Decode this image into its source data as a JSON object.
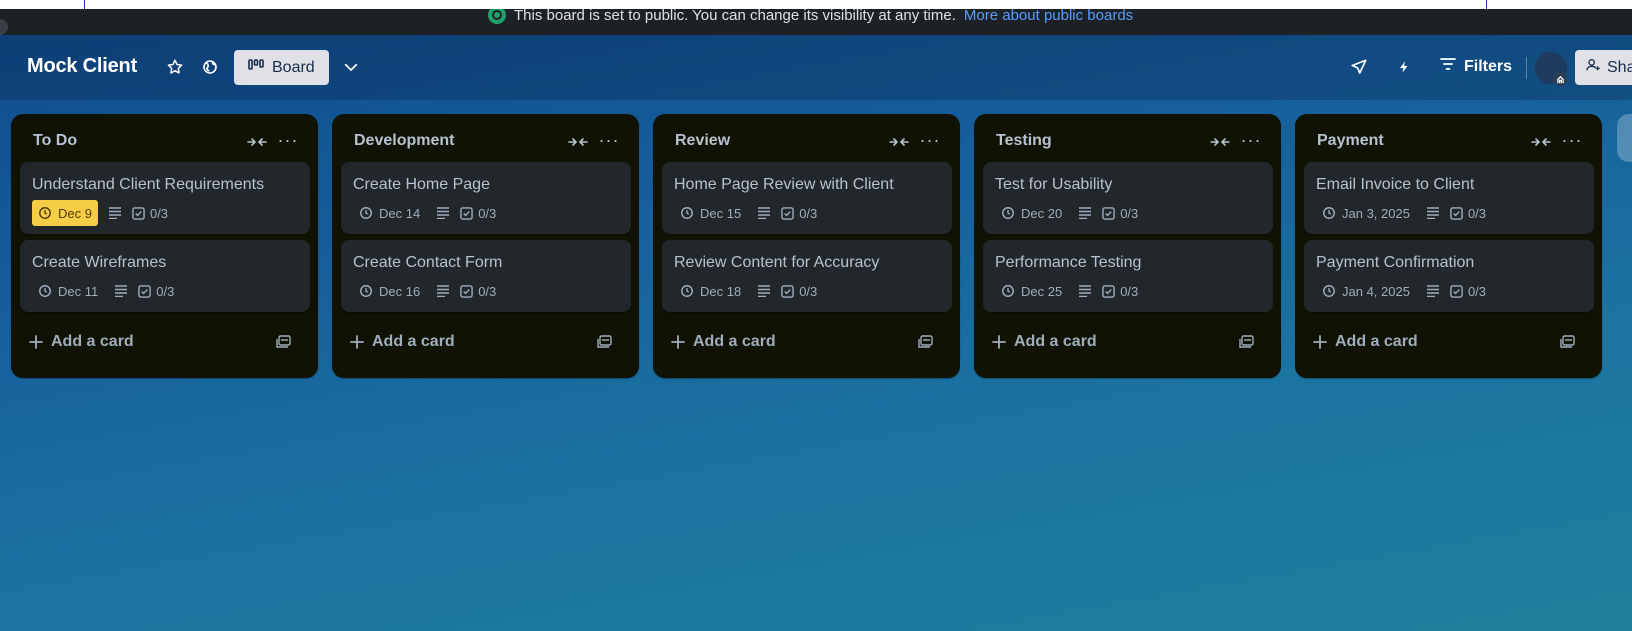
{
  "banner": {
    "text": "This board is set to public. You can change its visibility at any time.",
    "link": "More about public boards"
  },
  "header": {
    "board_title": "Mock Client",
    "view_label": "Board",
    "filters_label": "Filters",
    "share_label": "Share"
  },
  "lists": [
    {
      "title": "To Do",
      "cards": [
        {
          "title": "Understand Client Requirements",
          "due": "Dec 9",
          "due_soon": true,
          "checklist": "0/3"
        },
        {
          "title": "Create Wireframes",
          "due": "Dec 11",
          "due_soon": false,
          "checklist": "0/3"
        }
      ]
    },
    {
      "title": "Development",
      "cards": [
        {
          "title": "Create Home Page",
          "due": "Dec 14",
          "due_soon": false,
          "checklist": "0/3"
        },
        {
          "title": "Create Contact Form",
          "due": "Dec 16",
          "due_soon": false,
          "checklist": "0/3"
        }
      ]
    },
    {
      "title": "Review",
      "cards": [
        {
          "title": "Home Page Review with Client",
          "due": "Dec 15",
          "due_soon": false,
          "checklist": "0/3"
        },
        {
          "title": "Review Content for Accuracy",
          "due": "Dec 18",
          "due_soon": false,
          "checklist": "0/3"
        }
      ]
    },
    {
      "title": "Testing",
      "cards": [
        {
          "title": "Test for Usability",
          "due": "Dec 20",
          "due_soon": false,
          "checklist": "0/3"
        },
        {
          "title": "Performance Testing",
          "due": "Dec 25",
          "due_soon": false,
          "checklist": "0/3"
        }
      ]
    },
    {
      "title": "Payment",
      "cards": [
        {
          "title": "Email Invoice to Client",
          "due": "Jan 3, 2025",
          "due_soon": false,
          "checklist": "0/3"
        },
        {
          "title": "Payment Confirmation",
          "due": "Jan 4, 2025",
          "due_soon": false,
          "checklist": "0/3"
        }
      ]
    }
  ],
  "add_card_label": "Add a card",
  "icons": {
    "star": "star-icon",
    "visibility": "globe-icon",
    "view": "board-view-icon",
    "view_switch": "chevron-down-icon",
    "power_ups": "rocket-icon",
    "automation": "lightning-icon",
    "filters": "filter-icon",
    "share": "add-person-icon",
    "list_collapse": "collapse-arrows-icon",
    "list_menu": "more-horizontal-icon",
    "due": "clock-icon",
    "description": "description-lines-icon",
    "checklist": "checkbox-icon",
    "add": "plus-icon",
    "template": "card-template-icon"
  },
  "colors": {
    "due_soon_bg": "#f5cd47",
    "list_bg": "#101204",
    "card_bg": "#22272b",
    "link": "#579dff"
  }
}
